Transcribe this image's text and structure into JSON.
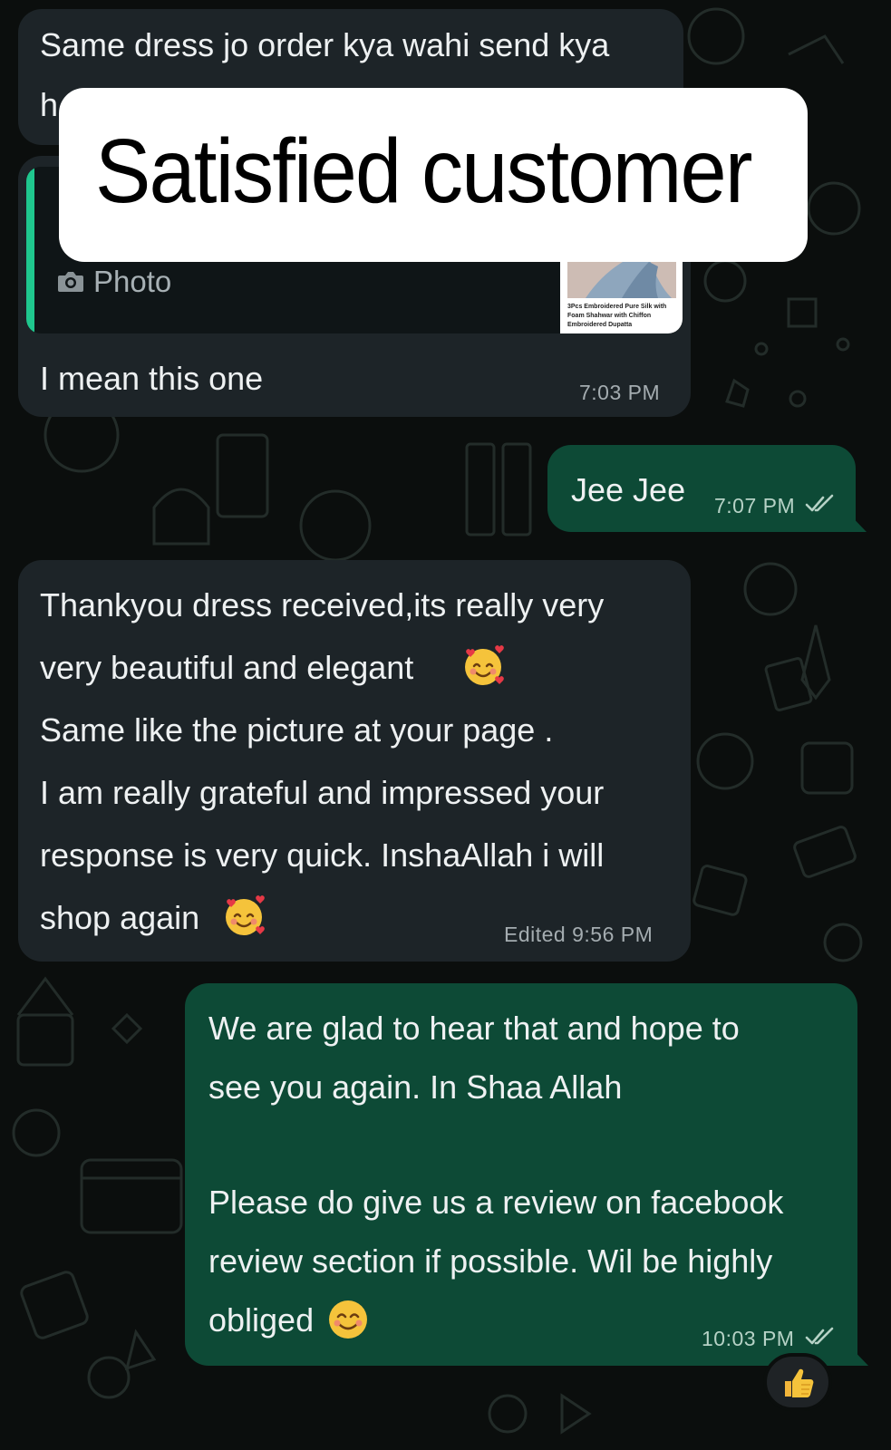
{
  "overlay": {
    "caption": "Satisfied customer"
  },
  "messages": {
    "m1": {
      "line1": "Same dress jo order kya wahi send kya",
      "line2": "h"
    },
    "m2": {
      "quote_label": "Photo",
      "thumb_caption_1": "3Pcs Embroidered Pure Silk with",
      "thumb_caption_2": "Foam Shahwar with Chiffon",
      "thumb_caption_3": "Embroidered Dupatta",
      "text": "I mean this one",
      "time": "7:03 PM"
    },
    "m3": {
      "text": "Jee Jee",
      "time": "7:07 PM"
    },
    "m4": {
      "lines": [
        "Thankyou dress received,its really very",
        "very beautiful and elegant",
        "Same like the picture at your page .",
        "I am really grateful and impressed your",
        "response is very quick. InshaAllah i will",
        "shop again"
      ],
      "time": "Edited 9:56 PM"
    },
    "m5": {
      "lines": [
        "We are glad to hear that and hope to",
        "see you again. In Shaa Allah",
        "Please do give us a review on facebook",
        "review section if possible. Wil be highly",
        "obliged"
      ],
      "time": "10:03 PM"
    }
  },
  "icons": {
    "camera": "camera-icon",
    "read_receipt": "double-check-icon",
    "reaction": "thumbs-up-emoji",
    "smiling_hearts": "smiling-face-with-hearts-emoji",
    "smiling": "smiling-face-emoji"
  },
  "colors": {
    "background": "#0b0e0d",
    "incoming_bubble": "#1d2428",
    "outgoing_bubble": "#0d4a36",
    "quote_accent": "#1fc78e",
    "read_tick": "#b6d2c6"
  }
}
